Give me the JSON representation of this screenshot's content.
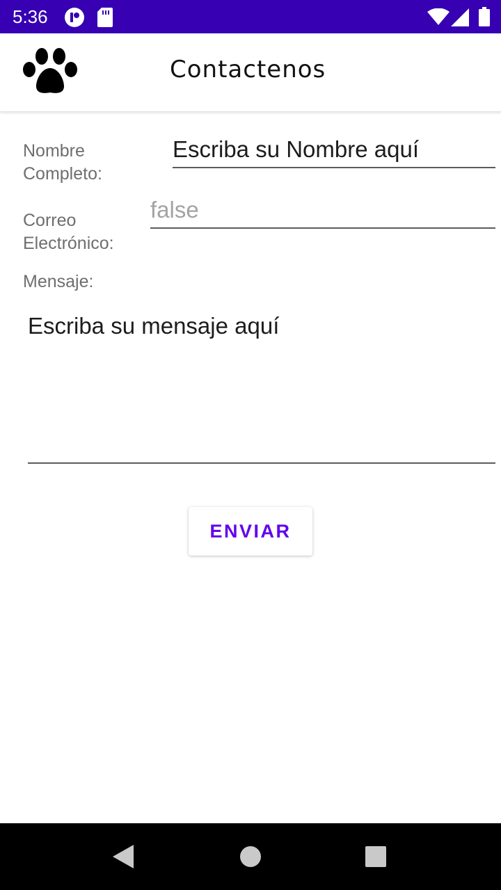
{
  "status_bar": {
    "time": "5:36",
    "background": "#3700b3",
    "left_icons": [
      "notification-app-icon",
      "sd-card-icon"
    ],
    "right_icons": [
      "wifi-icon",
      "cell-signal-icon",
      "battery-icon"
    ]
  },
  "app_bar": {
    "logo_icon": "paw-icon",
    "title": "Contactenos"
  },
  "form": {
    "name_label": "Nombre\nCompleto:",
    "name_value": "Escriba su Nombre aquí",
    "email_label": "Correo\nElectrónico:",
    "email_placeholder": "false",
    "message_label": "Mensaje:",
    "message_value": "Escriba su mensaje aquí",
    "send_label": "ENVIAR",
    "accent_color": "#6200ee"
  },
  "nav_bar": {
    "icons": [
      "back-icon",
      "home-icon",
      "recents-icon"
    ]
  }
}
